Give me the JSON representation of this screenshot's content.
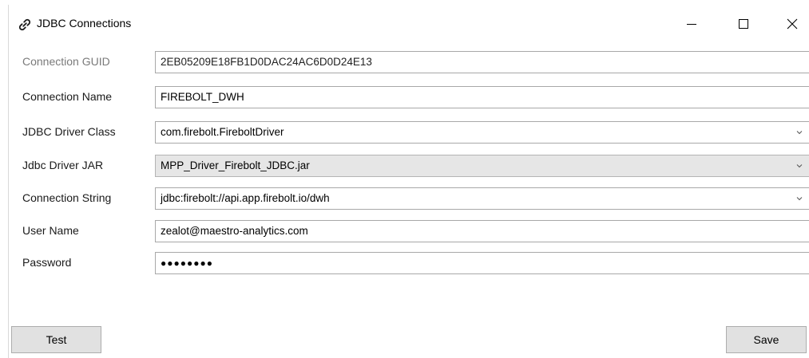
{
  "window": {
    "title": "JDBC Connections",
    "icon": "link-icon",
    "controls": {
      "minimize": "minimize-icon",
      "maximize": "maximize-icon",
      "close": "close-icon"
    }
  },
  "form": {
    "guid": {
      "label": "Connection GUID",
      "value": "2EB05209E18FB1D0DAC24AC6D0D24E13"
    },
    "name": {
      "label": "Connection Name",
      "value": "FIREBOLT_DWH"
    },
    "driver_class": {
      "label": "JDBC Driver Class",
      "value": "com.firebolt.FireboltDriver"
    },
    "driver_jar": {
      "label": "Jdbc Driver JAR",
      "value": "MPP_Driver_Firebolt_JDBC.jar"
    },
    "conn_string": {
      "label": "Connection String",
      "value": "jdbc:firebolt://api.app.firebolt.io/dwh"
    },
    "user": {
      "label": "User Name",
      "value": "zealot@maestro-analytics.com"
    },
    "password": {
      "label": "Password",
      "value": "●●●●●●●●"
    }
  },
  "buttons": {
    "test": "Test",
    "save": "Save"
  }
}
